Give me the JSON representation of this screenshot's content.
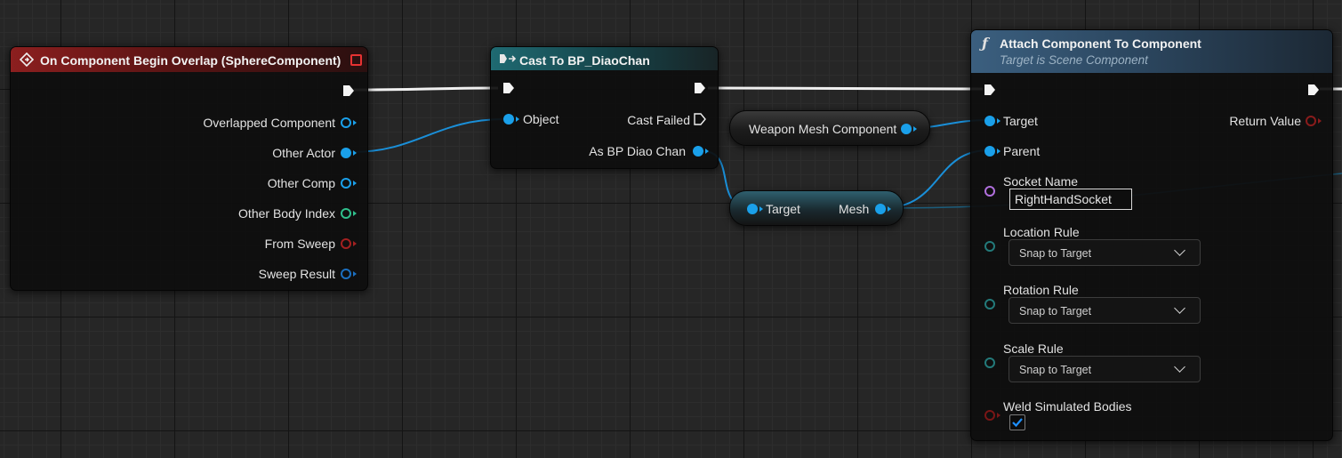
{
  "nodes": {
    "overlap_event": {
      "title": "On Component Begin Overlap (SphereComponent)",
      "pins": [
        "Overlapped Component",
        "Other Actor",
        "Other Comp",
        "Other Body Index",
        "From Sweep",
        "Sweep Result"
      ]
    },
    "cast": {
      "title": "Cast To BP_DiaoChan",
      "object_label": "Object",
      "cast_failed_label": "Cast Failed",
      "as_label": "As BP Diao Chan"
    },
    "weapon_var": {
      "label": "Weapon Mesh Component"
    },
    "get_mesh": {
      "target_label": "Target",
      "mesh_label": "Mesh"
    },
    "attach": {
      "title": "Attach Component To Component",
      "subtitle": "Target is Scene Component",
      "target_label": "Target",
      "parent_label": "Parent",
      "return_label": "Return Value",
      "socket_name_label": "Socket Name",
      "socket_name_value": "RightHandSocket",
      "location_rule_label": "Location Rule",
      "location_rule_value": "Snap to Target",
      "rotation_rule_label": "Rotation Rule",
      "rotation_rule_value": "Snap to Target",
      "scale_rule_label": "Scale Rule",
      "scale_rule_value": "Snap to Target",
      "weld_label": "Weld Simulated Bodies",
      "weld_checked": true
    }
  },
  "colors": {
    "object_pin": "#1aa0ea",
    "exec_wire": "#ffffff",
    "event_header": "#8c1f1f",
    "cast_header": "#1f6a72",
    "function_header": "#3b5f7f"
  }
}
